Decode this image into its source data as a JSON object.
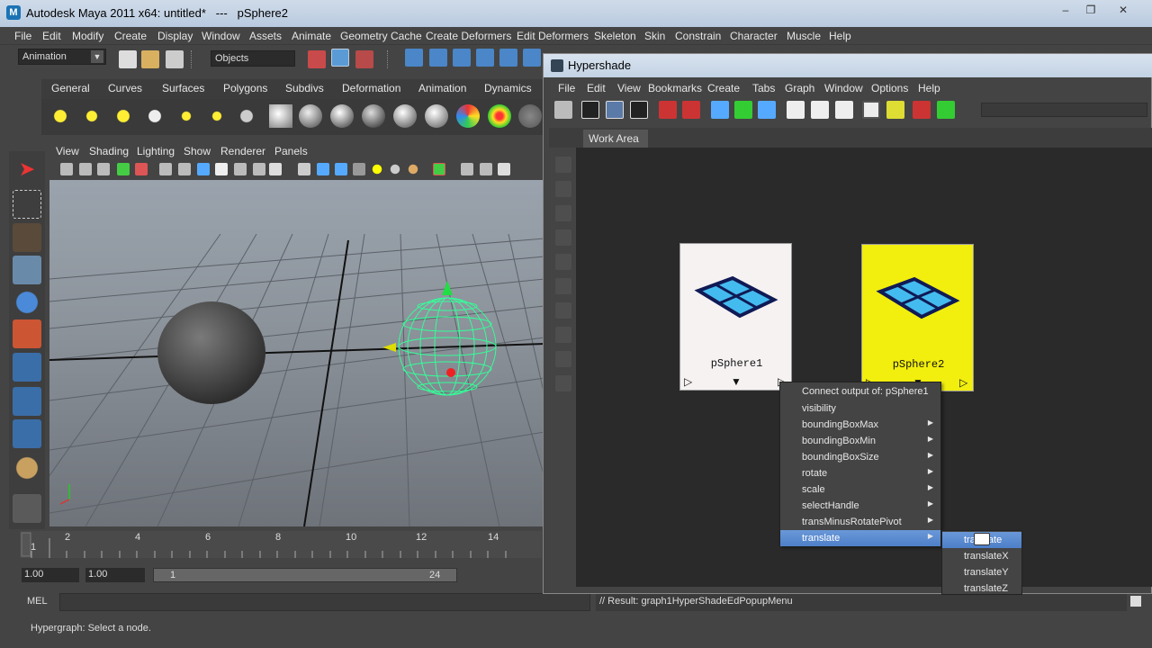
{
  "app": {
    "title": "Autodesk Maya 2011 x64: untitled*   ---   pSphere2",
    "window_controls": [
      "–",
      "❐",
      "✕"
    ]
  },
  "menus": [
    "File",
    "Edit",
    "Modify",
    "Create",
    "Display",
    "Window",
    "Assets",
    "Animate",
    "Geometry Cache",
    "Create Deformers",
    "Edit Deformers",
    "Skeleton",
    "Skin",
    "Constrain",
    "Character",
    "Muscle",
    "Help"
  ],
  "status_line": {
    "menu_set": "Animation",
    "selection_mask": "Objects"
  },
  "shelf": {
    "tabs": [
      "General",
      "Curves",
      "Surfaces",
      "Polygons",
      "Subdivs",
      "Deformation",
      "Animation",
      "Dynamics"
    ]
  },
  "panel": {
    "menus": [
      "View",
      "Shading",
      "Lighting",
      "Show",
      "Renderer",
      "Panels"
    ]
  },
  "time_slider": {
    "ticks": [
      "2",
      "4",
      "6",
      "8",
      "10",
      "12",
      "14"
    ],
    "current_frame": "1"
  },
  "range_slider": {
    "start_time": "1.00",
    "playback_start": "1.00",
    "range_start": "1",
    "range_end": "24"
  },
  "command_line": {
    "language": "MEL",
    "result": "// Result: graph1HyperShadeEdPopupMenu"
  },
  "help_line": "Hypergraph: Select a node.",
  "hypershade": {
    "title": "Hypershade",
    "menus": [
      "File",
      "Edit",
      "View",
      "Bookmarks",
      "Create",
      "Tabs",
      "Graph",
      "Window",
      "Options",
      "Help"
    ],
    "tab": "Work Area",
    "nodes": [
      {
        "name": "pSphere1",
        "bg": "#f6f2f2",
        "selected": false
      },
      {
        "name": "pSphere2",
        "bg": "#f2ee0e",
        "selected": true
      }
    ],
    "context_menu": {
      "header": "Connect output of: pSphere1",
      "items": [
        {
          "label": "visibility",
          "submenu": false
        },
        {
          "label": "boundingBoxMax",
          "submenu": true
        },
        {
          "label": "boundingBoxMin",
          "submenu": true
        },
        {
          "label": "boundingBoxSize",
          "submenu": true
        },
        {
          "label": "rotate",
          "submenu": true
        },
        {
          "label": "scale",
          "submenu": true
        },
        {
          "label": "selectHandle",
          "submenu": true
        },
        {
          "label": "transMinusRotatePivot",
          "submenu": true
        },
        {
          "label": "translate",
          "submenu": true,
          "active": true
        }
      ],
      "submenu": [
        "translate",
        "translateX",
        "translateY",
        "translateZ"
      ]
    }
  },
  "colors": {
    "ui_bg": "#444444",
    "highlight": "#5a8bd0",
    "wireframe": "#33ff99",
    "node_selected": "#f2ee0e"
  }
}
